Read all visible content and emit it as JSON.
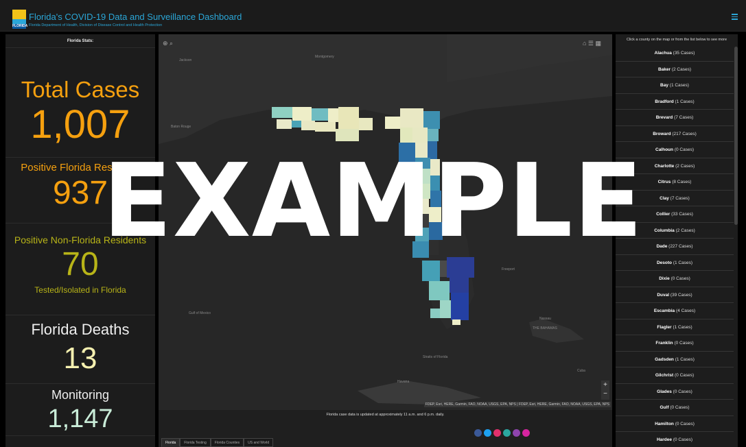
{
  "header": {
    "title": "Florida's COVID-19 Data and Surveillance Dashboard",
    "subtitle": "Florida Department of Health, Division of Disease Control and Health Protection",
    "logo_text": "FLORIDA"
  },
  "left_panel": {
    "heading": "Florida Stats:",
    "total_cases": {
      "label": "Total Cases",
      "value": "1,007"
    },
    "positive_residents": {
      "label": "Positive Florida Residents",
      "value": "937"
    },
    "positive_non_residents": {
      "label": "Positive Non-Florida Residents",
      "value": "70",
      "sub": "Tested/Isolated in Florida"
    },
    "deaths": {
      "label": "Florida Deaths",
      "value": "13"
    },
    "monitoring": {
      "label": "Monitoring",
      "value": "1,147"
    }
  },
  "map": {
    "labels": {
      "jackson": "Jackson",
      "montgomery": "Montgomery",
      "baton_rouge": "Baton Rouge",
      "gulf_of_mexico": "Gulf of Mexico",
      "havana": "Havana",
      "the_bahamas": "THE BAHAMAS",
      "straits": "Straits of Florida",
      "nassau": "Nassau",
      "freeport": "Freeport",
      "cuba": "Cuba"
    },
    "attribution": "FDEP, Esri, HERE, Garmin, FAO, NOAA, USGS, EPA, NPS | FDEP, Esri, HERE, Garmin, FAO, NOAA, USGS, EPA, NPS",
    "zoom_in": "+",
    "zoom_out": "−",
    "update_note": "Florida case data is updated at approximately 11 a.m. and 6 p.m. daily.",
    "tabs": [
      "Florida",
      "Florida Testing",
      "Florida Counties",
      "US and World"
    ],
    "social_colors": [
      "#3b5998",
      "#1da1f2",
      "#e1306c",
      "#2ba7a0",
      "#8e44ad",
      "#d6249f"
    ]
  },
  "right_panel": {
    "heading": "Click a county on the map or from the list below to see more",
    "counties": [
      {
        "name": "Alachua",
        "cases": "(35 Cases)"
      },
      {
        "name": "Baker",
        "cases": "(2 Cases)"
      },
      {
        "name": "Bay",
        "cases": "(1 Cases)"
      },
      {
        "name": "Bradford",
        "cases": "(1 Cases)"
      },
      {
        "name": "Brevard",
        "cases": "(7 Cases)"
      },
      {
        "name": "Broward",
        "cases": "(217 Cases)"
      },
      {
        "name": "Calhoun",
        "cases": "(0 Cases)"
      },
      {
        "name": "Charlotte",
        "cases": "(2 Cases)"
      },
      {
        "name": "Citrus",
        "cases": "(8 Cases)"
      },
      {
        "name": "Clay",
        "cases": "(7 Cases)"
      },
      {
        "name": "Collier",
        "cases": "(33 Cases)"
      },
      {
        "name": "Columbia",
        "cases": "(2 Cases)"
      },
      {
        "name": "Dade",
        "cases": "(227 Cases)"
      },
      {
        "name": "Desoto",
        "cases": "(1 Cases)"
      },
      {
        "name": "Dixie",
        "cases": "(0 Cases)"
      },
      {
        "name": "Duval",
        "cases": "(39 Cases)"
      },
      {
        "name": "Escambia",
        "cases": "(4 Cases)"
      },
      {
        "name": "Flagler",
        "cases": "(1 Cases)"
      },
      {
        "name": "Franklin",
        "cases": "(0 Cases)"
      },
      {
        "name": "Gadsden",
        "cases": "(1 Cases)"
      },
      {
        "name": "Gilchrist",
        "cases": "(0 Cases)"
      },
      {
        "name": "Glades",
        "cases": "(0 Cases)"
      },
      {
        "name": "Gulf",
        "cases": "(0 Cases)"
      },
      {
        "name": "Hamilton",
        "cases": "(0 Cases)"
      },
      {
        "name": "Hardee",
        "cases": "(0 Cases)"
      }
    ]
  },
  "watermark": "EXAMPLE"
}
